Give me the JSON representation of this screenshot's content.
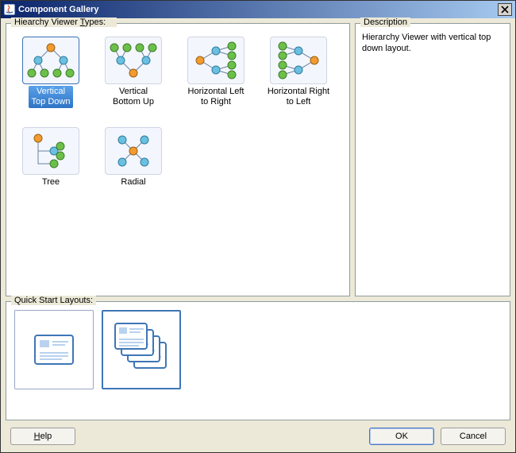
{
  "window": {
    "title": "Component Gallery"
  },
  "labels": {
    "types": "Hiearchy Viewer Types:",
    "description": "Description",
    "quick": "Quick Start Layouts:"
  },
  "types": {
    "items": [
      {
        "id": "vertical-top-down",
        "label": "Vertical\nTop Down",
        "selected": true
      },
      {
        "id": "vertical-bottom-up",
        "label": "Vertical\nBottom Up",
        "selected": false
      },
      {
        "id": "horizontal-left-right",
        "label": "Horizontal Left\nto Right",
        "selected": false
      },
      {
        "id": "horizontal-right-left",
        "label": "Horizontal Right\nto Left",
        "selected": false
      },
      {
        "id": "tree",
        "label": "Tree",
        "selected": false
      },
      {
        "id": "radial",
        "label": "Radial",
        "selected": false
      }
    ]
  },
  "description": {
    "text": "Hierarchy Viewer with vertical top down layout."
  },
  "quick_layouts": {
    "items": [
      {
        "id": "single-card",
        "selected": false
      },
      {
        "id": "cascaded-cards",
        "selected": true
      }
    ]
  },
  "buttons": {
    "help": "Help",
    "ok": "OK",
    "cancel": "Cancel"
  },
  "colors": {
    "orange": "#f29b2f",
    "green": "#6cc04a",
    "cyan": "#6bbfe0",
    "blue": "#3f76b6"
  }
}
